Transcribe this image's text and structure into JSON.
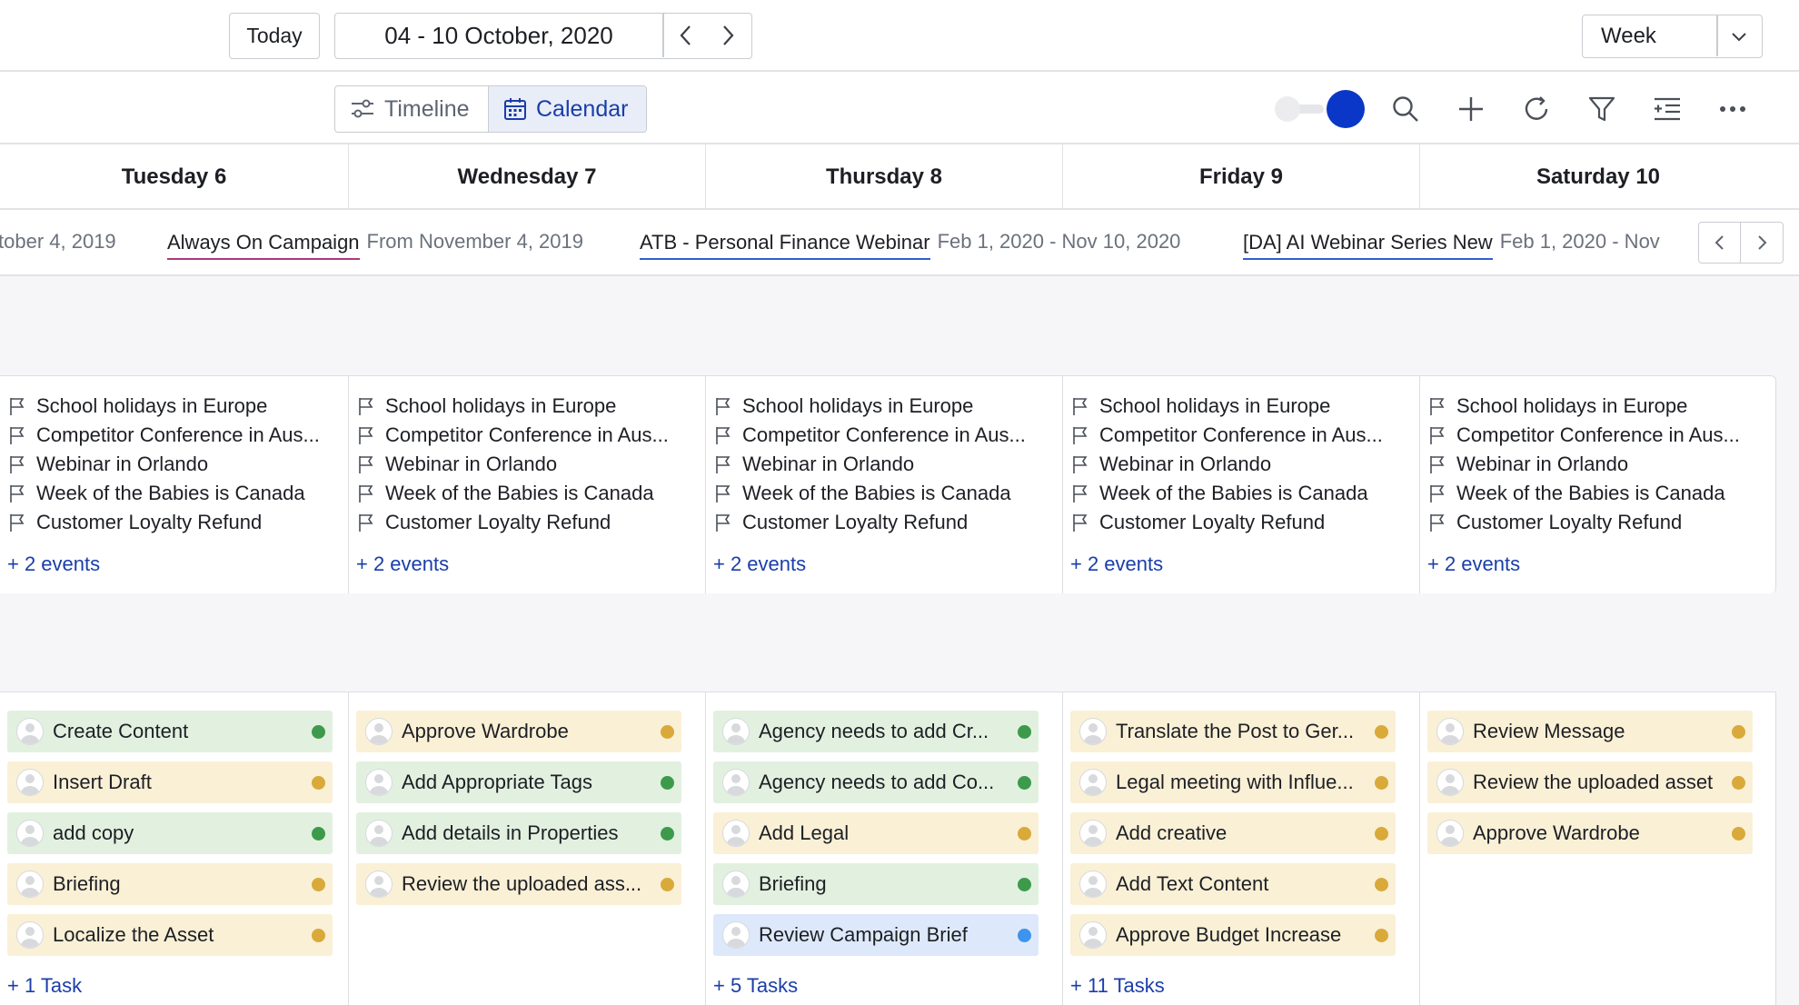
{
  "header": {
    "today_label": "Today",
    "date_range": "04 - 10 October, 2020",
    "view_mode": "Week"
  },
  "toolbar": {
    "timeline_label": "Timeline",
    "calendar_label": "Calendar",
    "toggle_on": true,
    "icons": [
      "search-icon",
      "plus-icon",
      "refresh-icon",
      "filter-icon",
      "list-settings-icon",
      "more-icon"
    ]
  },
  "days": [
    "Tuesday 6",
    "Wednesday 7",
    "Thursday 8",
    "Friday 9",
    "Saturday 10"
  ],
  "campaigns": [
    {
      "name": "",
      "dates": "tober 4, 2019",
      "color": ""
    },
    {
      "name": "Always On Campaign",
      "dates": "From November 4, 2019",
      "color": "#b0377e"
    },
    {
      "name": "ATB - Personal Finance Webinar",
      "dates": "Feb 1, 2020 - Nov 10, 2020",
      "color": "#2f5fd0"
    },
    {
      "name": "[DA] AI Webinar Series New",
      "dates": "Feb 1, 2020 - Nov",
      "color": "#2f5fd0"
    }
  ],
  "events": [
    {
      "items": [
        "School holidays in Europe",
        "Competitor Conference in Aus...",
        "Webinar in Orlando",
        "Week of the Babies is Canada",
        "Customer Loyalty Refund"
      ],
      "more": "+ 2 events"
    },
    {
      "items": [
        "School holidays in Europe",
        "Competitor Conference in Aus...",
        "Webinar in Orlando",
        "Week of the Babies is Canada",
        "Customer Loyalty Refund"
      ],
      "more": "+ 2 events"
    },
    {
      "items": [
        "School holidays in Europe",
        "Competitor Conference in Aus...",
        "Webinar in Orlando",
        "Week of the Babies is Canada",
        "Customer Loyalty Refund"
      ],
      "more": "+ 2 events"
    },
    {
      "items": [
        "School holidays in Europe",
        "Competitor Conference in Aus...",
        "Webinar in Orlando",
        "Week of the Babies is Canada",
        "Customer Loyalty Refund"
      ],
      "more": "+ 2 events"
    },
    {
      "items": [
        "School holidays in Europe",
        "Competitor Conference in Aus...",
        "Webinar in Orlando",
        "Week of the Babies is Canada",
        "Customer Loyalty Refund"
      ],
      "more": "+ 2 events"
    }
  ],
  "tasks": [
    {
      "items": [
        {
          "label": "Create Content",
          "status": "green"
        },
        {
          "label": "Insert Draft",
          "status": "yellow"
        },
        {
          "label": "add copy",
          "status": "green"
        },
        {
          "label": "Briefing",
          "status": "yellow"
        },
        {
          "label": "Localize the Asset",
          "status": "yellow"
        }
      ],
      "more": "+ 1 Task"
    },
    {
      "items": [
        {
          "label": "Approve Wardrobe",
          "status": "yellow"
        },
        {
          "label": "Add Appropriate Tags",
          "status": "green"
        },
        {
          "label": "Add details in Properties",
          "status": "green"
        },
        {
          "label": "Review the uploaded ass...",
          "status": "yellow"
        }
      ],
      "more": ""
    },
    {
      "items": [
        {
          "label": "Agency needs to add Cr...",
          "status": "green"
        },
        {
          "label": "Agency needs to add Co...",
          "status": "green"
        },
        {
          "label": "Add Legal",
          "status": "yellow"
        },
        {
          "label": "Briefing",
          "status": "green"
        },
        {
          "label": "Review Campaign Brief",
          "status": "blue"
        }
      ],
      "more": "+ 5 Tasks"
    },
    {
      "items": [
        {
          "label": "Translate the Post to Ger...",
          "status": "yellow"
        },
        {
          "label": "Legal meeting with Influe...",
          "status": "yellow"
        },
        {
          "label": "Add creative",
          "status": "yellow"
        },
        {
          "label": "Add Text Content",
          "status": "yellow"
        },
        {
          "label": "Approve Budget Increase",
          "status": "yellow"
        }
      ],
      "more": "+ 11 Tasks"
    },
    {
      "items": [
        {
          "label": "Review Message",
          "status": "yellow"
        },
        {
          "label": "Review the uploaded asset",
          "status": "yellow"
        },
        {
          "label": "Approve Wardrobe",
          "status": "yellow"
        }
      ],
      "more": ""
    }
  ],
  "colors": {
    "accent": "#0a37c7",
    "link": "#1a3ea8",
    "status_green": "#3d9a4b",
    "status_yellow": "#d9a93a",
    "status_blue": "#3d94ec"
  }
}
